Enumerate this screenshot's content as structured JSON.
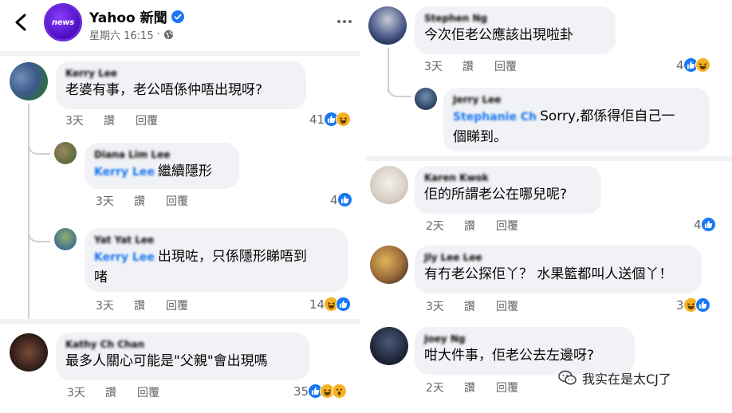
{
  "header": {
    "page_name": "Yahoo 新聞",
    "avatar_text": "news",
    "meta_time": "星期六 16:15",
    "meta_sep": "·"
  },
  "left_comments": [
    {
      "name": "Kerry Lee",
      "text": "老婆有事，老公唔係仲唔出現呀?",
      "time": "3天",
      "like": "讚",
      "reply": "回覆",
      "reaction_count": "41"
    },
    {
      "name": "Diana Lim Lee",
      "mention": "Kerry Lee",
      "text": "繼續隱形",
      "time": "3天",
      "like": "讚",
      "reply": "回覆",
      "reaction_count": "4"
    },
    {
      "name": "Yat Yat Lee",
      "mention": "Kerry Lee",
      "text_line1": "出現咗，只係隱形睇唔到",
      "text_line2": "啫",
      "time": "3天",
      "like": "讚",
      "reply": "回覆",
      "reaction_count": "14"
    },
    {
      "name": "Kathy Ch Chan",
      "text": "最多人關心可能是\"父親\"會出現嗎",
      "time": "3天",
      "like": "讚",
      "reply": "回覆",
      "reaction_count": "35"
    }
  ],
  "right_comments": [
    {
      "name": "Stephen Ng",
      "text": "今次佢老公應該出現啦卦",
      "time": "3天",
      "like": "讚",
      "reply": "回覆",
      "reaction_count": "4"
    },
    {
      "name": "Jerry Lee",
      "mention": "Stephanie Ch",
      "text_line1": "Sorry,都係得佢自己一",
      "text_line2": "個睇到。",
      "time": "",
      "like": "",
      "reply": ""
    },
    {
      "name": "Karen Kwok",
      "text": "佢的所謂老公在哪兒呢?",
      "time": "2天",
      "like": "讚",
      "reply": "回覆",
      "reaction_count": "4"
    },
    {
      "name": "Jly Lee Lee",
      "text": "有冇老公探佢丫？ 水果籃都叫人送個丫！",
      "time": "3天",
      "like": "讚",
      "reply": "回覆",
      "reaction_count": "3"
    },
    {
      "name": "Joey Ng",
      "text": "咁大件事，佢老公去左邊呀?",
      "time": "2天",
      "like": "讚",
      "reply": "回覆"
    }
  ],
  "watermark": {
    "text": "我实在是太CJ了"
  },
  "colors": {
    "bubble": "#f0f2f5",
    "link": "#1877f2",
    "muted": "#65676b",
    "verified": "#1877f2"
  },
  "icons": [
    "back-arrow-icon",
    "verified-badge-icon",
    "globe-icon",
    "more-options-icon",
    "like-reaction-icon",
    "haha-reaction-icon",
    "wow-reaction-icon",
    "wechat-icon"
  ]
}
